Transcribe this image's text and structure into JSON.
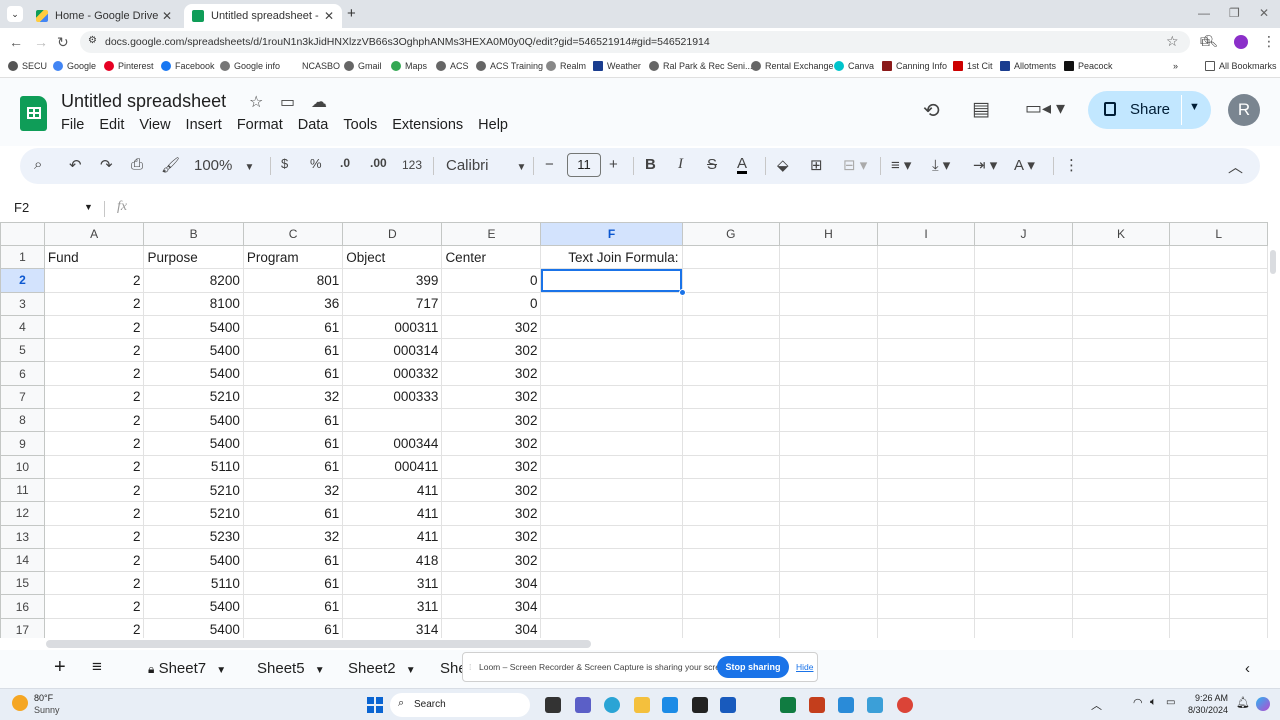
{
  "browser": {
    "tabs": [
      {
        "title": "Home - Google Drive",
        "active": false
      },
      {
        "title": "Untitled spreadsheet - Google",
        "active": true
      }
    ],
    "url": "docs.google.com/spreadsheets/d/1rouN1n3kJidHNXlzzVB66s3OghphANMs3HEXA0M0y0Q/edit?gid=546521914#gid=546521914",
    "bookmarks": [
      "SECU",
      "Google",
      "Pinterest",
      "Facebook",
      "Google info",
      "NCASBO",
      "Gmail",
      "Maps",
      "ACS",
      "ACS Training",
      "Realm",
      "Weather",
      "Ral Park & Rec Seni...",
      "Rental Exchange",
      "Canva",
      "Canning Info",
      "1st Cit",
      "Allotments",
      "Peacock"
    ],
    "all_bookmarks": "All Bookmarks"
  },
  "doc": {
    "title": "Untitled spreadsheet",
    "menu": [
      "File",
      "Edit",
      "View",
      "Insert",
      "Format",
      "Data",
      "Tools",
      "Extensions",
      "Help"
    ],
    "share_label": "Share",
    "avatar_initial": "R"
  },
  "toolbar": {
    "zoom": "100%",
    "currency": "$",
    "percent": "%",
    "dec_decrease": ".0",
    "dec_increase": ".00",
    "format_123": "123",
    "font": "Calibri",
    "font_size": "11"
  },
  "formula_bar": {
    "cell_ref": "F2",
    "fx": "fx",
    "value": ""
  },
  "grid": {
    "columns": [
      "A",
      "B",
      "C",
      "D",
      "E",
      "F",
      "G",
      "H",
      "I",
      "J",
      "K",
      "L"
    ],
    "selected_col": "F",
    "selected_row": 2,
    "rows": [
      {
        "n": "1",
        "cells": [
          "Fund",
          "Purpose",
          "Program",
          "Object",
          "Center",
          "Text Join Formula:"
        ]
      },
      {
        "n": "2",
        "cells": [
          "2",
          "8200",
          "801",
          "399",
          "0",
          ""
        ]
      },
      {
        "n": "3",
        "cells": [
          "2",
          "8100",
          "36",
          "717",
          "0",
          ""
        ]
      },
      {
        "n": "4",
        "cells": [
          "2",
          "5400",
          "61",
          "000311",
          "302",
          ""
        ]
      },
      {
        "n": "5",
        "cells": [
          "2",
          "5400",
          "61",
          "000314",
          "302",
          ""
        ]
      },
      {
        "n": "6",
        "cells": [
          "2",
          "5400",
          "61",
          "000332",
          "302",
          ""
        ]
      },
      {
        "n": "7",
        "cells": [
          "2",
          "5210",
          "32",
          "000333",
          "302",
          ""
        ]
      },
      {
        "n": "8",
        "cells": [
          "2",
          "5400",
          "61",
          "",
          "302",
          ""
        ]
      },
      {
        "n": "9",
        "cells": [
          "2",
          "5400",
          "61",
          "000344",
          "302",
          ""
        ]
      },
      {
        "n": "10",
        "cells": [
          "2",
          "5110",
          "61",
          "000411",
          "302",
          ""
        ]
      },
      {
        "n": "11",
        "cells": [
          "2",
          "5210",
          "32",
          "411",
          "302",
          ""
        ]
      },
      {
        "n": "12",
        "cells": [
          "2",
          "5210",
          "61",
          "411",
          "302",
          ""
        ]
      },
      {
        "n": "13",
        "cells": [
          "2",
          "5230",
          "32",
          "411",
          "302",
          ""
        ]
      },
      {
        "n": "14",
        "cells": [
          "2",
          "5400",
          "61",
          "418",
          "302",
          ""
        ]
      },
      {
        "n": "15",
        "cells": [
          "2",
          "5110",
          "61",
          "311",
          "304",
          ""
        ]
      },
      {
        "n": "16",
        "cells": [
          "2",
          "5400",
          "61",
          "311",
          "304",
          ""
        ]
      },
      {
        "n": "17",
        "cells": [
          "2",
          "5400",
          "61",
          "314",
          "304",
          ""
        ]
      }
    ]
  },
  "sheets": {
    "tabs": [
      "Sheet7",
      "Sheet5",
      "Sheet2",
      "She"
    ]
  },
  "loom": {
    "message": "Loom – Screen Recorder & Screen Capture is sharing your screen.",
    "stop_label": "Stop sharing",
    "hide_label": "Hide"
  },
  "taskbar": {
    "weather_temp": "80°F",
    "weather_desc": "Sunny",
    "search_label": "Search",
    "time": "9:26 AM",
    "date": "8/30/2024"
  },
  "colors": {
    "accent": "#1a73e8",
    "sheets_green": "#0f9d58",
    "share_bg": "#c2e7ff",
    "selection_header": "#d3e3fd"
  }
}
